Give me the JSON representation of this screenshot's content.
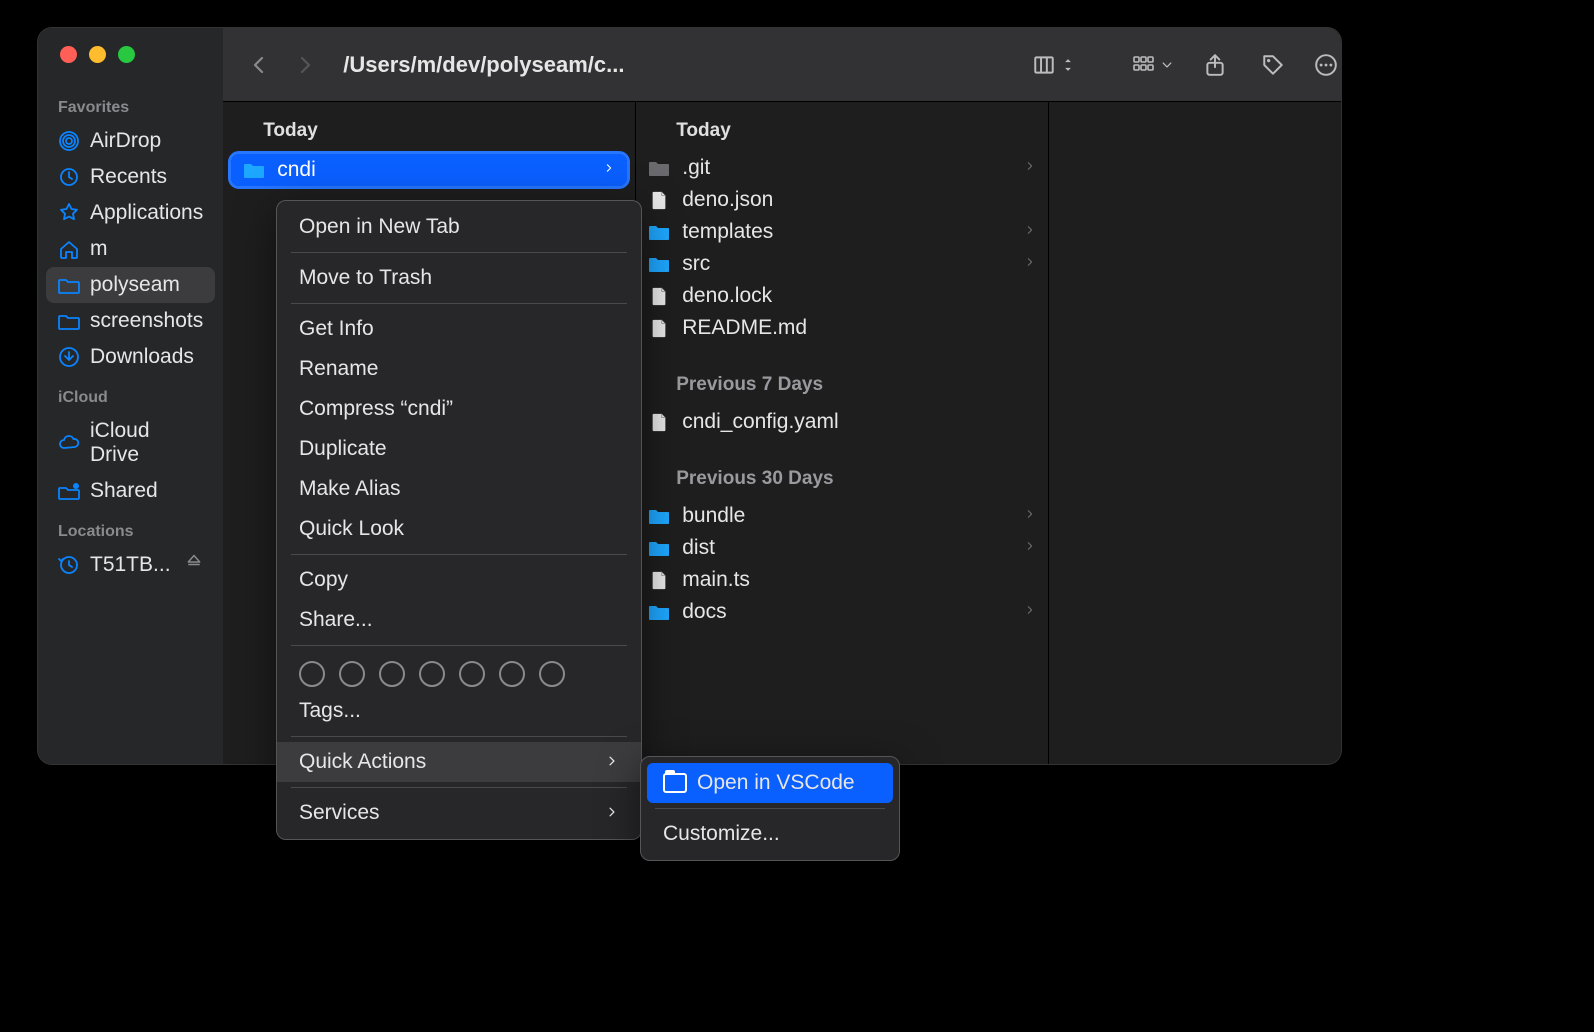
{
  "window": {
    "path_title": "/Users/m/dev/polyseam/c..."
  },
  "sidebar": {
    "favorites_heading": "Favorites",
    "icloud_heading": "iCloud",
    "locations_heading": "Locations",
    "favorites": [
      {
        "label": "AirDrop",
        "icon": "airdrop"
      },
      {
        "label": "Recents",
        "icon": "clock"
      },
      {
        "label": "Applications",
        "icon": "apps"
      },
      {
        "label": "m",
        "icon": "house"
      },
      {
        "label": "polyseam",
        "icon": "folder",
        "active": true
      },
      {
        "label": "screenshots",
        "icon": "folder"
      },
      {
        "label": "Downloads",
        "icon": "download"
      }
    ],
    "icloud": [
      {
        "label": "iCloud Drive",
        "icon": "cloud"
      },
      {
        "label": "Shared",
        "icon": "shared"
      }
    ],
    "locations": [
      {
        "label": "T51TB...",
        "icon": "timemachine",
        "eject": true
      }
    ]
  },
  "columns": {
    "col1_heading": "Today",
    "col1_items": [
      {
        "label": "cndi",
        "type": "folder",
        "selected": true
      }
    ],
    "col2_heading": "Today",
    "col2_today": [
      {
        "label": ".git",
        "type": "folder-dim",
        "arrow": true
      },
      {
        "label": "deno.json",
        "type": "doc"
      },
      {
        "label": "templates",
        "type": "folder",
        "arrow": true
      },
      {
        "label": "src",
        "type": "folder",
        "arrow": true
      },
      {
        "label": "deno.lock",
        "type": "doc"
      },
      {
        "label": "README.md",
        "type": "doc-md"
      }
    ],
    "col2_prev7_heading": "Previous 7 Days",
    "col2_prev7": [
      {
        "label": "cndi_config.yaml",
        "type": "doc-yaml"
      }
    ],
    "col2_prev30_heading": "Previous 30 Days",
    "col2_prev30": [
      {
        "label": "bundle",
        "type": "folder",
        "arrow": true
      },
      {
        "label": "dist",
        "type": "folder",
        "arrow": true
      },
      {
        "label": "main.ts",
        "type": "doc-ts"
      },
      {
        "label": "docs",
        "type": "folder",
        "arrow": true
      }
    ]
  },
  "context_menu": {
    "open_new_tab": "Open in New Tab",
    "move_to_trash": "Move to Trash",
    "get_info": "Get Info",
    "rename": "Rename",
    "compress": "Compress “cndi”",
    "duplicate": "Duplicate",
    "make_alias": "Make Alias",
    "quick_look": "Quick Look",
    "copy": "Copy",
    "share": "Share...",
    "tags": "Tags...",
    "quick_actions": "Quick Actions",
    "services": "Services"
  },
  "submenu": {
    "open_vscode": "Open in VSCode",
    "customize": "Customize..."
  }
}
